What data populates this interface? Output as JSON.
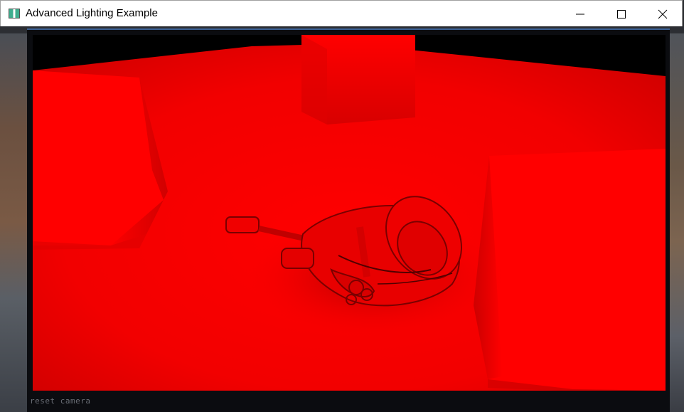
{
  "window": {
    "title": "Advanced Lighting Example",
    "app_icon": "app-window-icon"
  },
  "titlebar_buttons": [
    {
      "name": "minimize-button",
      "icon": "minimize-icon"
    },
    {
      "name": "maximize-button",
      "icon": "maximize-icon"
    },
    {
      "name": "close-button",
      "icon": "close-icon"
    }
  ],
  "scene": {
    "status_text": "reset camera",
    "colors": {
      "light": "#ff0000",
      "mid": "#e60000",
      "dark": "#8a0000",
      "background": "#000000"
    }
  }
}
